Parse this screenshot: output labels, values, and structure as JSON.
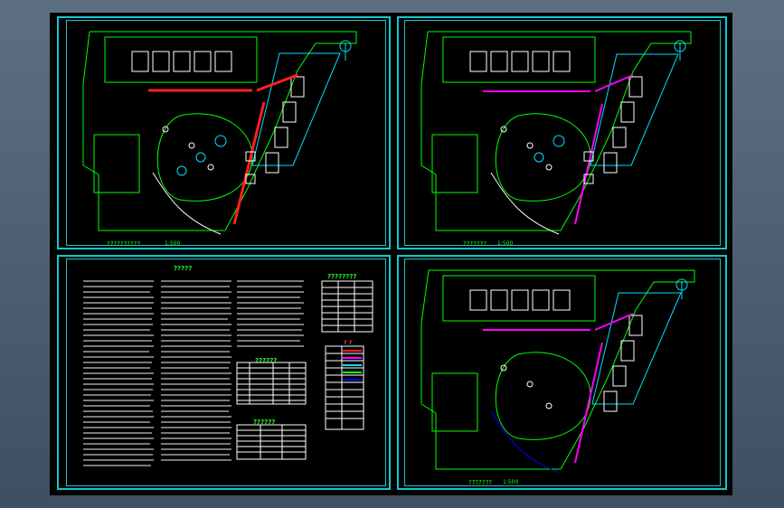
{
  "app": {
    "viewport_background": "#000000",
    "frame_color": "#12c8cf",
    "drawing_accent_colors": [
      "#21ff21",
      "#ff1f1f",
      "#00e0ff",
      "#ff00ff",
      "#0000ff",
      "#ffffff"
    ]
  },
  "sheets": {
    "top_left": {
      "title": "??????????",
      "scale": "1:500"
    },
    "top_right": {
      "title": "???????",
      "scale": "1:500"
    },
    "bottom_right": {
      "title": "???????",
      "scale": "1:500"
    },
    "bottom_left": {
      "notes_title": "?????",
      "table_title_1": "????????",
      "table_title_2": "??????",
      "table_title_3": "??????",
      "legend_title": "? ?"
    }
  },
  "icons": [
    "tree-icon",
    "north-arrow-icon"
  ]
}
